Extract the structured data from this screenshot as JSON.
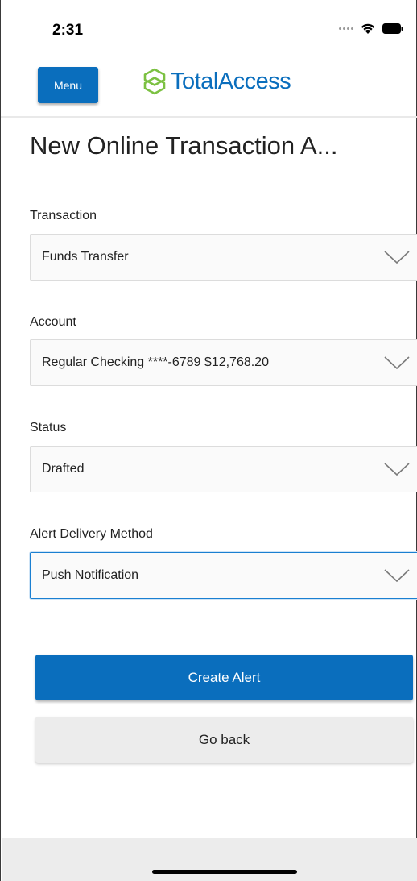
{
  "status_bar": {
    "time": "2:31"
  },
  "header": {
    "menu_label": "Menu",
    "logo_text": "TotalAccess",
    "brand_color": "#0a6ebd",
    "logo_color": "#7cc142"
  },
  "page": {
    "title": "New Online Transaction A..."
  },
  "form": {
    "transaction": {
      "label": "Transaction",
      "value": "Funds Transfer"
    },
    "account": {
      "label": "Account",
      "value": "Regular Checking ****-6789 $12,768.20"
    },
    "status": {
      "label": "Status",
      "value": "Drafted"
    },
    "delivery": {
      "label": "Alert Delivery Method",
      "value": "Push Notification"
    }
  },
  "actions": {
    "create_label": "Create Alert",
    "back_label": "Go back"
  },
  "icons": [
    "wifi-icon",
    "battery-icon",
    "logo-icon",
    "chevron-down-icon"
  ]
}
